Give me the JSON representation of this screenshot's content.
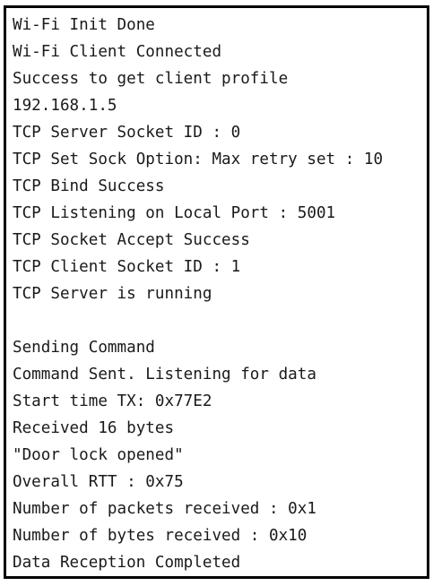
{
  "console": {
    "lines": [
      "Wi-Fi Init Done",
      "Wi-Fi Client Connected",
      "Success to get client profile",
      "192.168.1.5",
      "TCP Server Socket ID : 0",
      "TCP Set Sock Option: Max retry set : 10",
      "TCP Bind Success",
      "TCP Listening on Local Port : 5001",
      "TCP Socket Accept Success",
      "TCP Client Socket ID : 1",
      "TCP Server is running",
      "",
      "Sending Command",
      "Command Sent. Listening for data",
      "Start time TX: 0x77E2",
      "Received 16 bytes",
      "\"Door lock opened\"",
      "Overall RTT : 0x75",
      "Number of packets received : 0x1",
      "Number of bytes received : 0x10",
      "Data Reception Completed"
    ]
  }
}
